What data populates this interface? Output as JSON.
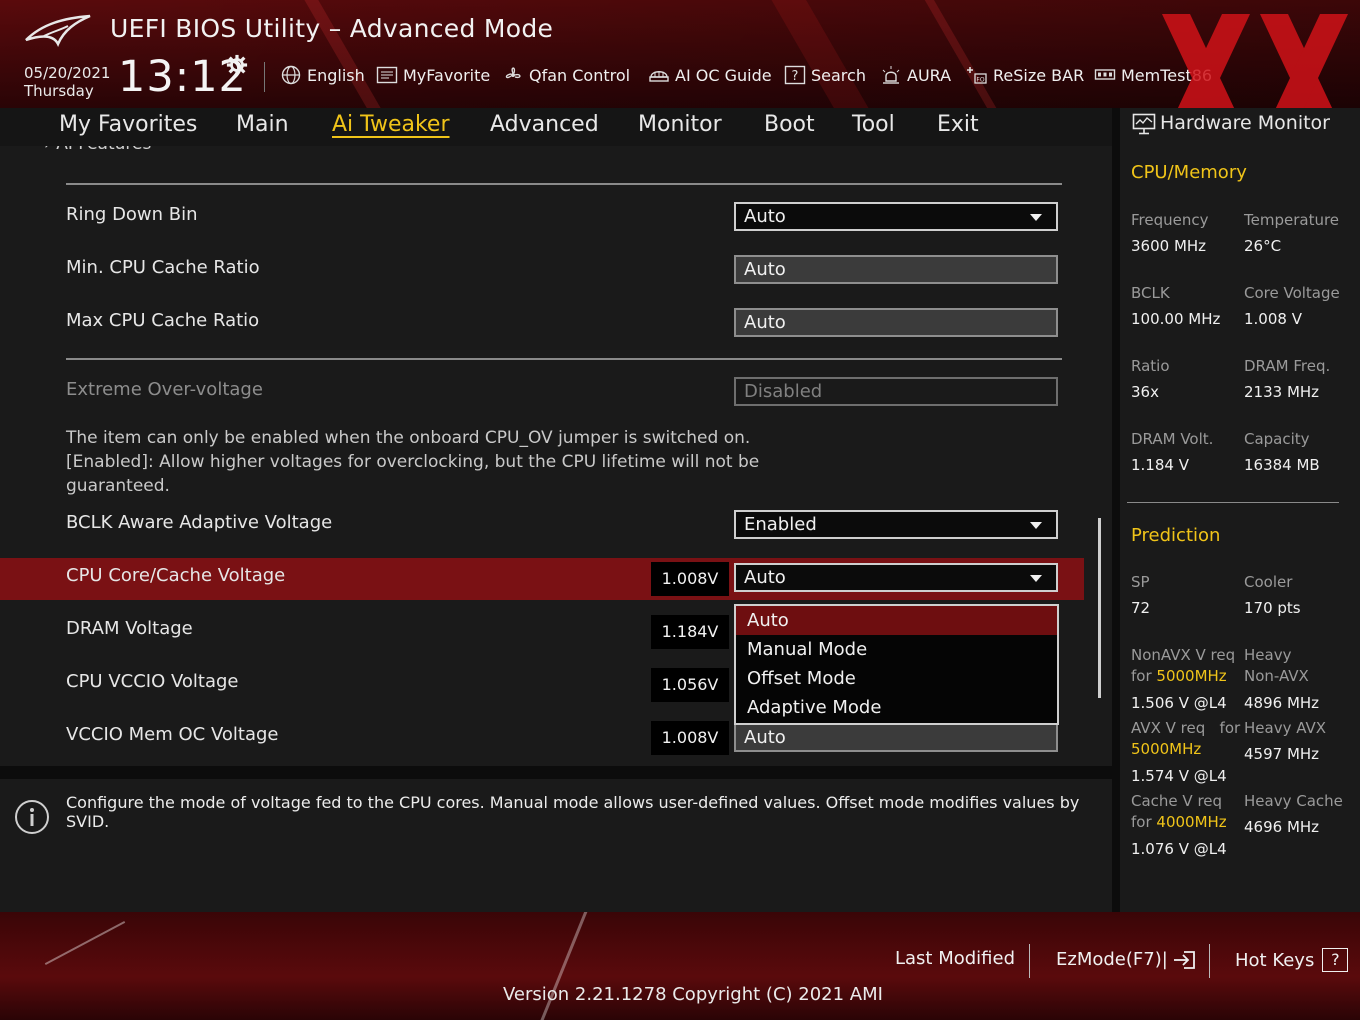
{
  "header": {
    "title": "UEFI BIOS Utility – Advanced Mode",
    "date": "05/20/2021",
    "day": "Thursday",
    "time": "13:12",
    "tools": [
      {
        "label": "English",
        "icon": "globe-icon"
      },
      {
        "label": "MyFavorite",
        "icon": "favorite-list-icon"
      },
      {
        "label": "Qfan Control",
        "icon": "fan-icon"
      },
      {
        "label": "AI OC Guide",
        "icon": "ai-oc-icon"
      },
      {
        "label": "Search",
        "icon": "search-help-icon"
      },
      {
        "label": "AURA",
        "icon": "aura-light-icon"
      },
      {
        "label": "ReSize BAR",
        "icon": "resize-bar-icon"
      },
      {
        "label": "MemTest86",
        "icon": "memory-icon"
      }
    ]
  },
  "nav": {
    "tabs": [
      "My Favorites",
      "Main",
      "Ai Tweaker",
      "Advanced",
      "Monitor",
      "Boot",
      "Tool",
      "Exit"
    ],
    "active": "Ai Tweaker"
  },
  "main": {
    "partial_item": "AI Features",
    "rows": {
      "ring_down_bin": {
        "label": "Ring Down Bin",
        "value": "Auto"
      },
      "min_cache": {
        "label": "Min. CPU Cache Ratio",
        "value": "Auto"
      },
      "max_cache": {
        "label": "Max CPU Cache Ratio",
        "value": "Auto"
      },
      "extreme_ov": {
        "label": "Extreme Over-voltage",
        "value": "Disabled"
      },
      "bclk_aware": {
        "label": "BCLK Aware Adaptive Voltage",
        "value": "Enabled"
      },
      "cpu_core_cache": {
        "label": "CPU Core/Cache Voltage",
        "reading": "1.008V",
        "value": "Auto"
      },
      "dram_voltage": {
        "label": "DRAM Voltage",
        "reading": "1.184V"
      },
      "cpu_vccio": {
        "label": "CPU VCCIO Voltage",
        "reading": "1.056V"
      },
      "vccio_mem": {
        "label": "VCCIO Mem OC Voltage",
        "reading": "1.008V",
        "value": "Auto"
      }
    },
    "help_lines": [
      "The item can only be enabled when the onboard CPU_OV jumper is switched on.",
      "[Enabled]: Allow higher voltages for overclocking, but the CPU lifetime will not be",
      "guaranteed."
    ],
    "dropdown_options": [
      "Auto",
      "Manual Mode",
      "Offset Mode",
      "Adaptive Mode"
    ],
    "dropdown_selected": "Auto"
  },
  "info": {
    "text": "Configure the mode of voltage fed to the CPU cores. Manual mode allows user-defined values. Offset mode modifies values by SVID."
  },
  "hw_monitor": {
    "title": "Hardware Monitor",
    "cpu_memory": {
      "heading": "CPU/Memory",
      "frequency_label": "Frequency",
      "frequency": "3600 MHz",
      "temperature_label": "Temperature",
      "temperature": "26°C",
      "bclk_label": "BCLK",
      "bclk": "100.00 MHz",
      "core_voltage_label": "Core Voltage",
      "core_voltage": "1.008 V",
      "ratio_label": "Ratio",
      "ratio": "36x",
      "dram_freq_label": "DRAM Freq.",
      "dram_freq": "2133 MHz",
      "dram_volt_label": "DRAM Volt.",
      "dram_volt": "1.184 V",
      "capacity_label": "Capacity",
      "capacity": "16384 MB"
    },
    "prediction": {
      "heading": "Prediction",
      "sp_label": "SP",
      "sp": "72",
      "cooler_label": "Cooler",
      "cooler": "170 pts",
      "nonavx_label_1": "NonAVX V req",
      "nonavx_label_2": "for",
      "nonavx_freq": "5000MHz",
      "nonavx_value": "1.506 V @L4",
      "heavy_nonavx_label_1": "Heavy",
      "heavy_nonavx_label_2": "Non-AVX",
      "heavy_nonavx_value": "4896 MHz",
      "avx_label_1": "AVX V req",
      "avx_label_for": "for",
      "avx_freq": "5000MHz",
      "avx_value": "1.574 V @L4",
      "heavy_avx_label": "Heavy AVX",
      "heavy_avx_value": "4597 MHz",
      "cache_label_1": "Cache V req",
      "cache_label_2": "for",
      "cache_freq": "4000MHz",
      "cache_value": "1.076 V @L4",
      "heavy_cache_label": "Heavy Cache",
      "heavy_cache_value": "4696 MHz"
    }
  },
  "footer": {
    "last_modified": "Last Modified",
    "ezmode": "EzMode(F7)|",
    "hotkeys": "Hot Keys",
    "hotkeys_key": "?",
    "version": "Version 2.21.1278 Copyright (C) 2021 AMI"
  },
  "colors": {
    "accent_yellow": "#f0c419",
    "highlight_red": "#7a1114",
    "header_red": "#5a0a0c"
  }
}
